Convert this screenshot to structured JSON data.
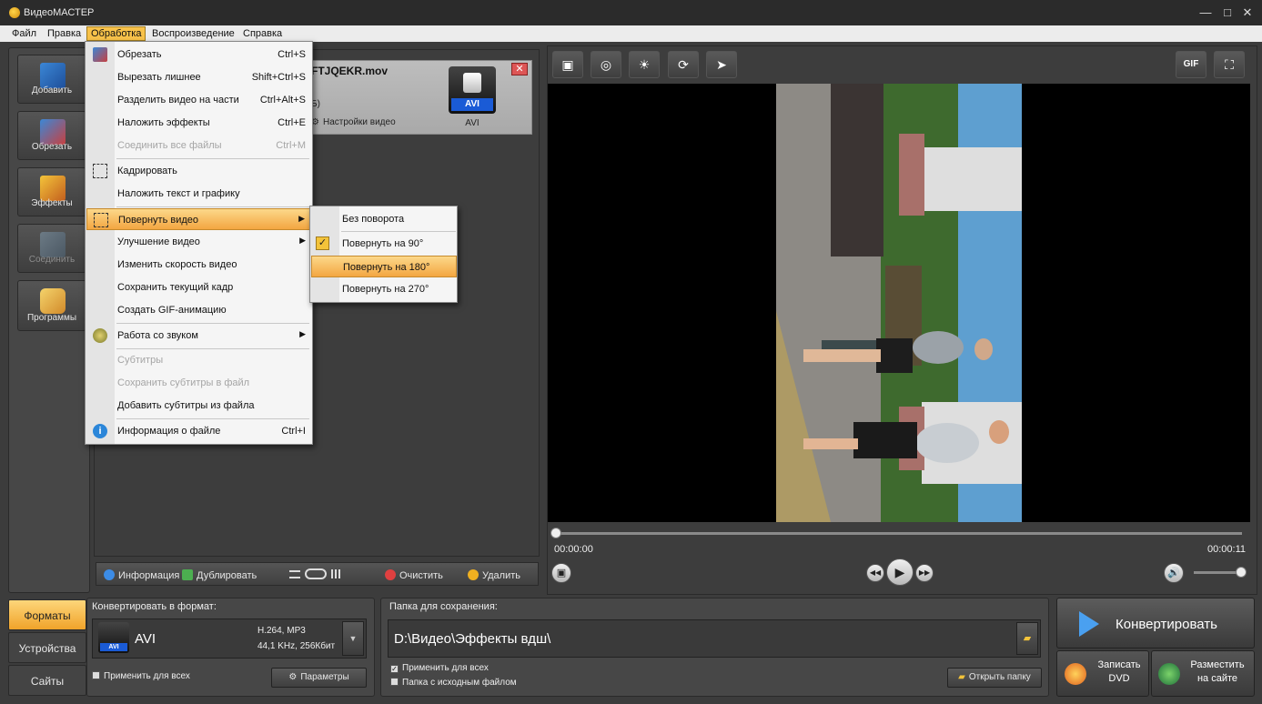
{
  "window": {
    "title": "ВидеоМАСТЕР",
    "minimize": "—",
    "restore": "□",
    "close": "✕"
  },
  "menubar": [
    "Файл",
    "Правка",
    "Обработка",
    "Воспроизведение",
    "Справка"
  ],
  "sidebar": [
    {
      "label": "Добавить",
      "icon": "film-add-icon"
    },
    {
      "label": "Обрезать",
      "icon": "film-cut-icon"
    },
    {
      "label": "Эффекты",
      "icon": "magic-wand-icon"
    },
    {
      "label": "Соединить",
      "icon": "film-join-icon"
    },
    {
      "label": "Программы",
      "icon": "programs-icon"
    }
  ],
  "file": {
    "name": "FTJQEKR.mov",
    "sub": "Б)",
    "settings": "Настройки видео",
    "format_badge": "AVI",
    "format_label": "AVI",
    "close": "✕"
  },
  "file_toolbar": {
    "info": "Информация",
    "duplicate": "Дублировать",
    "clear": "Очистить",
    "delete": "Удалить"
  },
  "menu": {
    "items": [
      {
        "label": "Обрезать",
        "shortcut": "Ctrl+S"
      },
      {
        "label": "Вырезать лишнее",
        "shortcut": "Shift+Ctrl+S"
      },
      {
        "label": "Разделить видео на части",
        "shortcut": "Ctrl+Alt+S"
      },
      {
        "label": "Наложить эффекты",
        "shortcut": "Ctrl+E"
      },
      {
        "label": "Соединить все файлы",
        "shortcut": "Ctrl+M"
      },
      {
        "label": "Кадрировать",
        "shortcut": ""
      },
      {
        "label": "Наложить текст и графику",
        "shortcut": ""
      },
      {
        "label": "Повернуть видео",
        "shortcut": ""
      },
      {
        "label": "Улучшение видео",
        "shortcut": ""
      },
      {
        "label": "Изменить скорость видео",
        "shortcut": ""
      },
      {
        "label": "Сохранить текущий кадр",
        "shortcut": ""
      },
      {
        "label": "Создать GIF-анимацию",
        "shortcut": ""
      },
      {
        "label": "Работа со звуком",
        "shortcut": ""
      },
      {
        "label": "Субтитры",
        "shortcut": ""
      },
      {
        "label": "Сохранить субтитры в файл",
        "shortcut": ""
      },
      {
        "label": "Добавить субтитры из файла",
        "shortcut": ""
      },
      {
        "label": "Информация о файле",
        "shortcut": "Ctrl+I"
      }
    ]
  },
  "submenu": {
    "items": [
      {
        "label": "Без поворота"
      },
      {
        "label": "Повернуть на 90°"
      },
      {
        "label": "Повернуть на 180°"
      },
      {
        "label": "Повернуть на 270°"
      }
    ]
  },
  "player": {
    "tools": [
      "crop-icon",
      "effects-icon",
      "brightness-icon",
      "rotate-icon",
      "speed-icon"
    ],
    "gif": "GIF",
    "time_start": "00:00:00",
    "time_end": "00:00:11",
    "progress": 0
  },
  "bottom": {
    "tabs": [
      "Форматы",
      "Устройства",
      "Сайты"
    ],
    "convert_to_label": "Конвертировать в формат:",
    "format_name": "AVI",
    "format_badge": "AVI",
    "format_spec1": "H.264, MP3",
    "format_spec2": "44,1 KHz, 256Кбит",
    "apply_all": "Применить для всех",
    "params": "Параметры",
    "save_folder_label": "Папка для сохранения:",
    "save_path": "D:\\Видео\\Эффекты вдш\\",
    "apply_all2": "Применить для всех",
    "source_folder": "Папка с исходным файлом",
    "open_folder": "Открыть папку",
    "convert": "Конвертировать",
    "burn_dvd_1": "Записать",
    "burn_dvd_2": "DVD",
    "publish_1": "Разместить",
    "publish_2": "на сайте"
  },
  "colors": {
    "accent": "#f8c24a",
    "dark": "#3c3c3c",
    "blue": "#1a5bd6"
  }
}
